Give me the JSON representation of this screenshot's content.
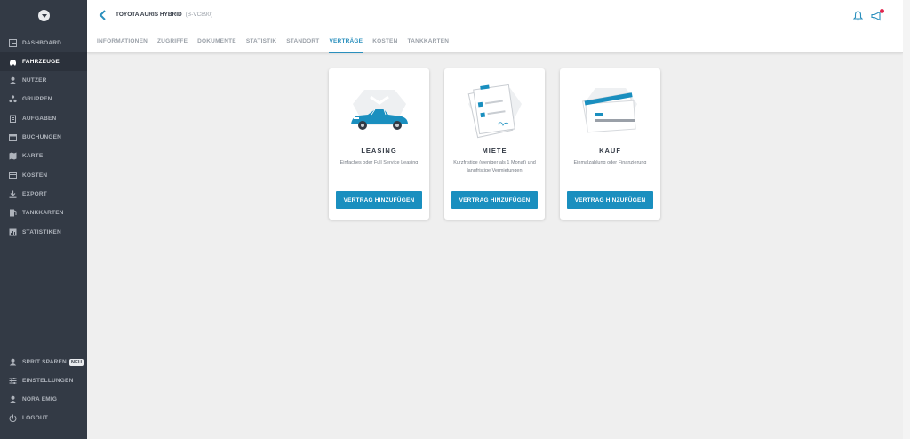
{
  "sidebar": {
    "items": [
      {
        "label": "DASHBOARD",
        "icon": "dashboard-icon"
      },
      {
        "label": "FAHRZEUGE",
        "icon": "car-icon",
        "active": true
      },
      {
        "label": "NUTZER",
        "icon": "user-icon"
      },
      {
        "label": "GRUPPEN",
        "icon": "groups-icon"
      },
      {
        "label": "AUFGABEN",
        "icon": "clipboard-icon"
      },
      {
        "label": "BUCHUNGEN",
        "icon": "calendar-icon"
      },
      {
        "label": "KARTE",
        "icon": "map-icon"
      },
      {
        "label": "KOSTEN",
        "icon": "wallet-icon"
      },
      {
        "label": "EXPORT",
        "icon": "download-icon"
      },
      {
        "label": "TANKKARTEN",
        "icon": "fuel-icon"
      },
      {
        "label": "STATISTIKEN",
        "icon": "chart-icon"
      }
    ],
    "bottom_items": [
      {
        "label": "SPRIT SPAREN",
        "icon": "user-icon",
        "badge": "NEU"
      },
      {
        "label": "EINSTELLUNGEN",
        "icon": "sliders-icon"
      },
      {
        "label": "NORA EMIG",
        "icon": "user-icon"
      },
      {
        "label": "LOGOUT",
        "icon": "power-icon"
      }
    ]
  },
  "header": {
    "vehicle_name": "TOYOTA AURIS HYBRID",
    "vehicle_plate": "(B-VC890)",
    "tabs": [
      {
        "label": "INFORMATIONEN"
      },
      {
        "label": "ZUGRIFFE"
      },
      {
        "label": "DOKUMENTE"
      },
      {
        "label": "STATISTIK"
      },
      {
        "label": "STANDORT"
      },
      {
        "label": "VERTRÄGE",
        "active": true
      },
      {
        "label": "KOSTEN"
      },
      {
        "label": "TANKKARTEN"
      }
    ]
  },
  "cards": [
    {
      "title": "LEASING",
      "description": "Einfaches oder Full Service Leasing",
      "button": "VERTRAG HINZUFÜGEN"
    },
    {
      "title": "MIETE",
      "description": "Kurzfristige (weniger als 1 Monat) und langfristige Vermietungen",
      "button": "VERTRAG HINZUFÜGEN"
    },
    {
      "title": "KAUF",
      "description": "Einmalzahlung oder Finanzierung",
      "button": "VERTRAG HINZUFÜGEN"
    }
  ],
  "colors": {
    "sidebar_bg": "#333a45",
    "accent": "#2a8fbd",
    "button": "#1a8fbf",
    "notification_dot": "#e0254d"
  }
}
